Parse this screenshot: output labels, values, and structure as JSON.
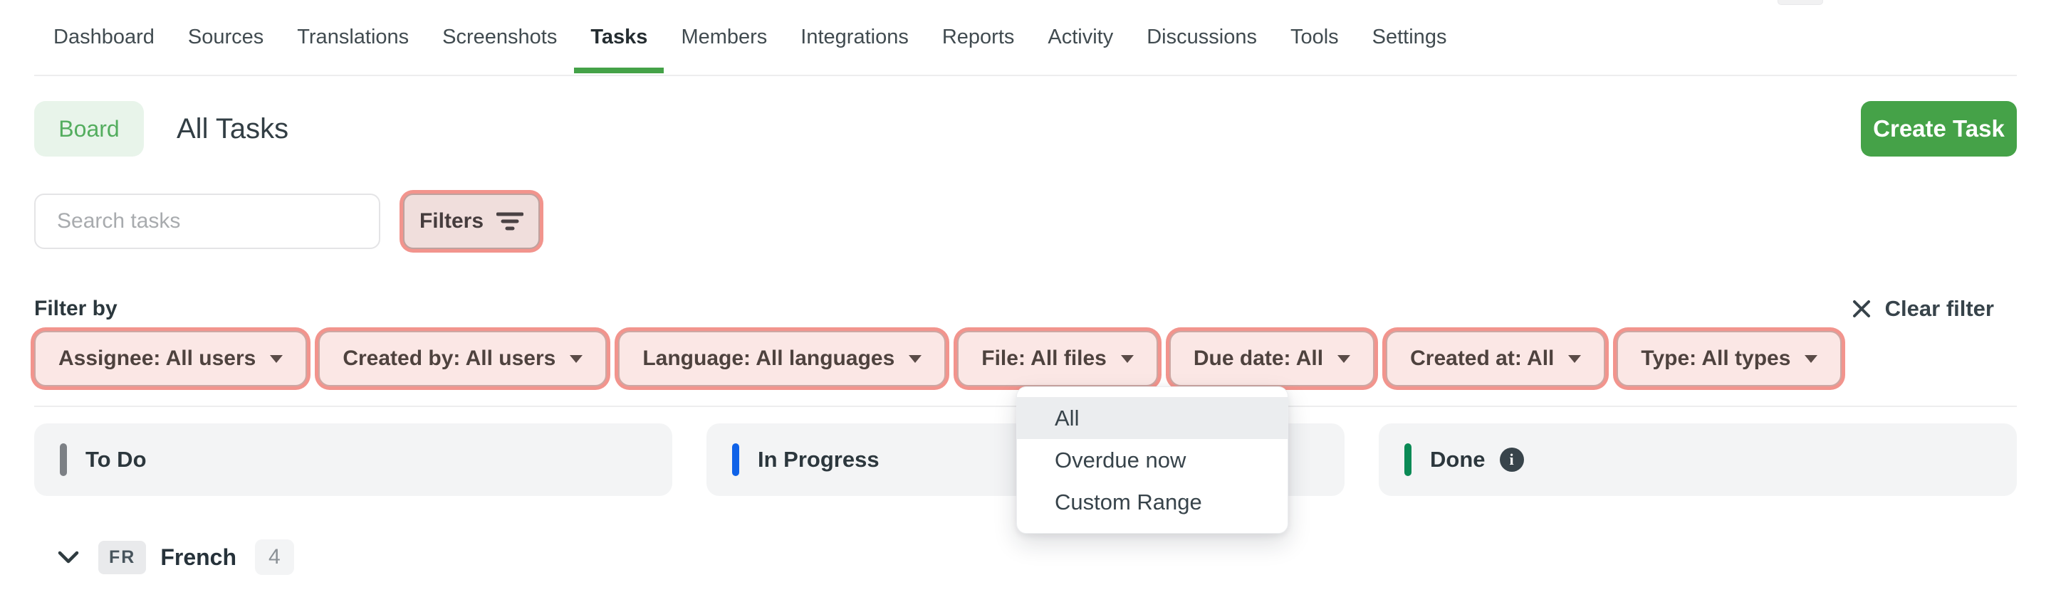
{
  "nav": {
    "items": [
      {
        "label": "Dashboard",
        "active": false
      },
      {
        "label": "Sources",
        "active": false
      },
      {
        "label": "Translations",
        "active": false
      },
      {
        "label": "Screenshots",
        "active": false
      },
      {
        "label": "Tasks",
        "active": true
      },
      {
        "label": "Members",
        "active": false
      },
      {
        "label": "Integrations",
        "active": false
      },
      {
        "label": "Reports",
        "active": false
      },
      {
        "label": "Activity",
        "active": false
      },
      {
        "label": "Discussions",
        "active": false
      },
      {
        "label": "Tools",
        "active": false
      },
      {
        "label": "Settings",
        "active": false
      }
    ]
  },
  "header": {
    "board_label": "Board",
    "title": "All Tasks",
    "create_task_label": "Create Task"
  },
  "search": {
    "placeholder": "Search tasks",
    "filters_label": "Filters"
  },
  "filter_bar": {
    "label": "Filter by",
    "clear_label": "Clear filter",
    "chips": [
      {
        "label": "Assignee: All users"
      },
      {
        "label": "Created by: All users"
      },
      {
        "label": "Language: All languages"
      },
      {
        "label": "File: All files"
      },
      {
        "label": "Due date: All"
      },
      {
        "label": "Created at: All"
      },
      {
        "label": "Type: All types"
      }
    ]
  },
  "due_date_menu": {
    "items": [
      {
        "label": "All",
        "highlighted": true
      },
      {
        "label": "Overdue now",
        "highlighted": false
      },
      {
        "label": "Custom Range",
        "highlighted": false
      }
    ]
  },
  "board": {
    "columns": [
      {
        "label": "To Do",
        "status_color": "#7c8085",
        "has_info": false
      },
      {
        "label": "In Progress",
        "status_color": "#0f62e8",
        "has_info": false
      },
      {
        "label": "Done",
        "status_color": "#0a8a55",
        "has_info": true
      }
    ]
  },
  "group_row": {
    "lang_code": "FR",
    "lang_name": "French",
    "count": "4"
  },
  "colors": {
    "accent_green": "#45a248",
    "board_pill_bg": "#e8f4ea",
    "filter_ring_pink": "#f2948d",
    "chip_bg": "#fbe7e5",
    "column_bg": "#f3f4f5",
    "menu_highlight": "#ebedef"
  }
}
